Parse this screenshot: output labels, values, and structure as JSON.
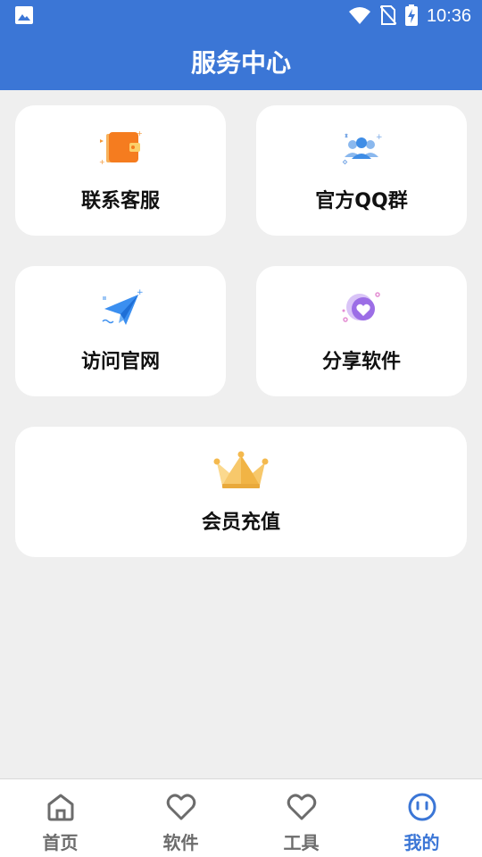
{
  "status": {
    "time": "10:36"
  },
  "header": {
    "title": "服务中心"
  },
  "cards": [
    {
      "label": "联系客服",
      "icon": "wallet-icon"
    },
    {
      "label": "官方QQ群",
      "icon": "group-icon"
    },
    {
      "label": "访问官网",
      "icon": "paper-plane-icon"
    },
    {
      "label": "分享软件",
      "icon": "heart-badge-icon"
    },
    {
      "label": "会员充值",
      "icon": "crown-icon"
    }
  ],
  "nav": {
    "items": [
      {
        "label": "首页",
        "icon": "home-icon"
      },
      {
        "label": "软件",
        "icon": "heart-outline-icon"
      },
      {
        "label": "工具",
        "icon": "heart-outline-icon"
      },
      {
        "label": "我的",
        "icon": "smiley-icon",
        "active": true
      }
    ]
  },
  "colors": {
    "primary": "#3b76d6",
    "background": "#efefef",
    "inactive": "#6c6c6c"
  }
}
